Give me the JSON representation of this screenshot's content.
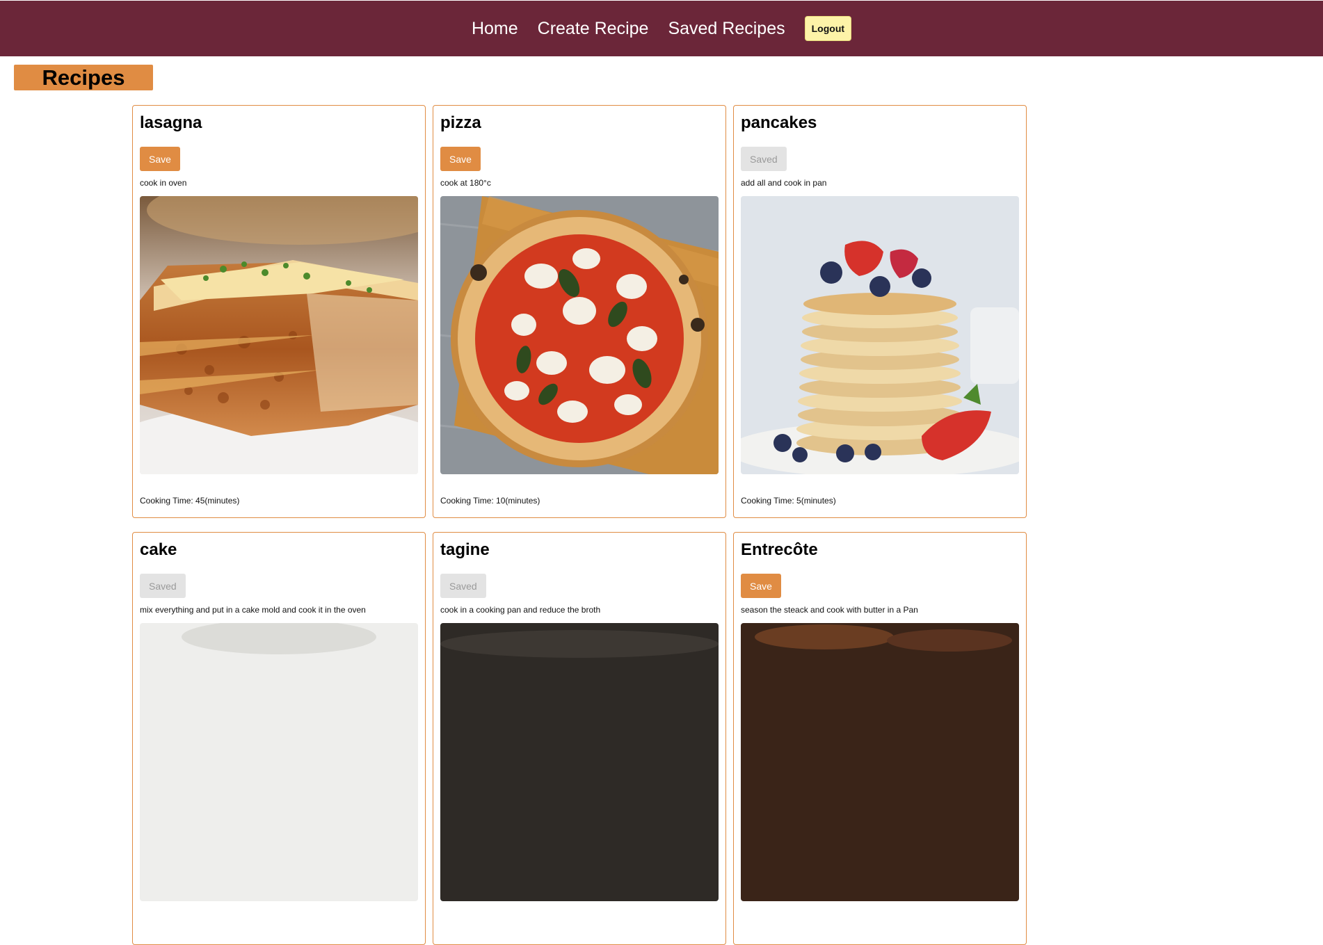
{
  "nav": {
    "home": "Home",
    "create": "Create Recipe",
    "saved": "Saved Recipes",
    "logout": "Logout"
  },
  "page": {
    "title": "Recipes"
  },
  "cooking_label": "Cooking Time: ",
  "recipes": [
    {
      "name": "lasagna",
      "button": "Save",
      "instructions": "cook in oven",
      "time": "45(minutes)",
      "image": "lasagna-photo"
    },
    {
      "name": "pizza",
      "button": "Save",
      "instructions": "cook at 180°c",
      "time": "10(minutes)",
      "image": "pizza-photo"
    },
    {
      "name": "pancakes",
      "button": "Saved",
      "instructions": "add all and cook in pan",
      "time": "5(minutes)",
      "image": "pancakes-photo"
    },
    {
      "name": "cake",
      "button": "Saved",
      "instructions": "mix everything and put in a cake mold and cook it in the oven",
      "time": "",
      "image": "cake-photo"
    },
    {
      "name": "tagine",
      "button": "Saved",
      "instructions": "cook in a cooking pan and reduce the broth",
      "time": "",
      "image": "tagine-photo"
    },
    {
      "name": "Entrecôte",
      "button": "Save",
      "instructions": "season the steack and cook with butter in a Pan",
      "time": "",
      "image": "entrecote-photo"
    }
  ],
  "colors": {
    "navbar": "#6b2639",
    "accent": "#e08c43",
    "logout": "#fdf3a8",
    "saved_disabled": "#e3e3e3"
  }
}
